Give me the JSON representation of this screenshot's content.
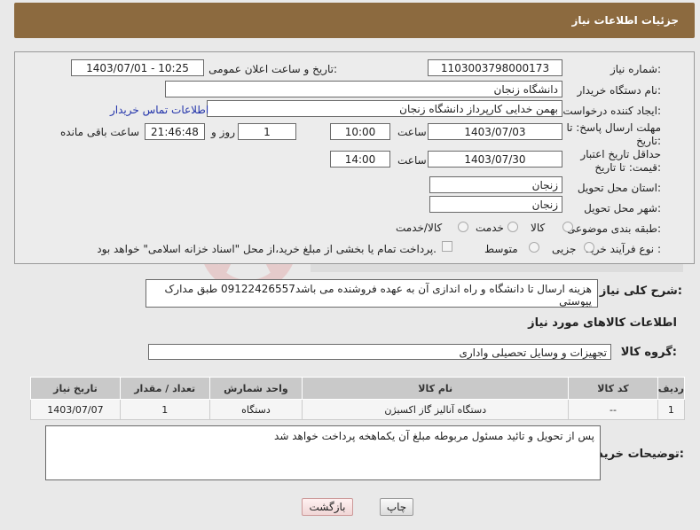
{
  "header": {
    "title": "جزئیات اطلاعات نیاز"
  },
  "form": {
    "need_number_label": "شماره نیاز:",
    "need_number": "1103003798000173",
    "announce_label": "تاریخ و ساعت اعلان عمومی:",
    "announce_value": "1403/07/01 - 10:25",
    "buyer_org_label": "نام دستگاه خریدار:",
    "buyer_org": "دانشگاه زنجان",
    "requester_label": "ایجاد کننده درخواست:",
    "requester": "بهمن خدایی کارپرداز دانشگاه زنجان",
    "contact_link": "اطلاعات تماس خریدار",
    "deadline_label": "مهلت ارسال پاسخ: تا تاریخ:",
    "deadline_date": "1403/07/03",
    "time_label": "ساعت",
    "deadline_time": "10:00",
    "day_value": "1",
    "day_label": "روز و",
    "remaining_time": "21:46:48",
    "remaining_label": "ساعت باقی مانده",
    "validity_label": "حداقل تاریخ اعتبار قیمت: تا تاریخ:",
    "validity_date": "1403/07/30",
    "validity_time": "14:00",
    "province_label": "استان محل تحویل:",
    "province": "زنجان",
    "city_label": "شهر محل تحویل:",
    "city": "زنجان",
    "category_label": "طبقه بندی موضوعی:",
    "category_options": [
      "کالا",
      "خدمت",
      "کالا/خدمت"
    ],
    "process_label": "نوع فرآیند خرید :",
    "process_options": [
      "جزیی",
      "متوسط"
    ],
    "payment_note": "پرداخت تمام یا بخشی از مبلغ خرید،از محل \"اسناد خزانه اسلامی\" خواهد بود."
  },
  "description": {
    "label": "شرح کلی نیاز:",
    "text": "هزینه ارسال تا دانشگاه و راه اندازی آن به عهده فروشنده می باشد09122426557 طبق مدارک پیوستی"
  },
  "goods_section": {
    "title": "اطلاعات کالاهای مورد نیاز",
    "group_label": "گروه کالا:",
    "group_value": "تجهیزات و وسایل تحصیلی واداری"
  },
  "table": {
    "headers": [
      "ردیف",
      "کد کالا",
      "نام کالا",
      "واحد شمارش",
      "تعداد / مقدار",
      "تاریخ نیاز"
    ],
    "rows": [
      [
        "1",
        "--",
        "دستگاه آنالیز گاز اکسیژن",
        "دستگاه",
        "1",
        "1403/07/07"
      ]
    ]
  },
  "buyer_notes": {
    "label": "توضیحات خریدار:",
    "text": "پس از تحویل و تائید مسئول مربوطه مبلغ آن یکماهخه پرداخت خواهد شد"
  },
  "buttons": {
    "print": "چاپ",
    "back": "بازگشت"
  }
}
